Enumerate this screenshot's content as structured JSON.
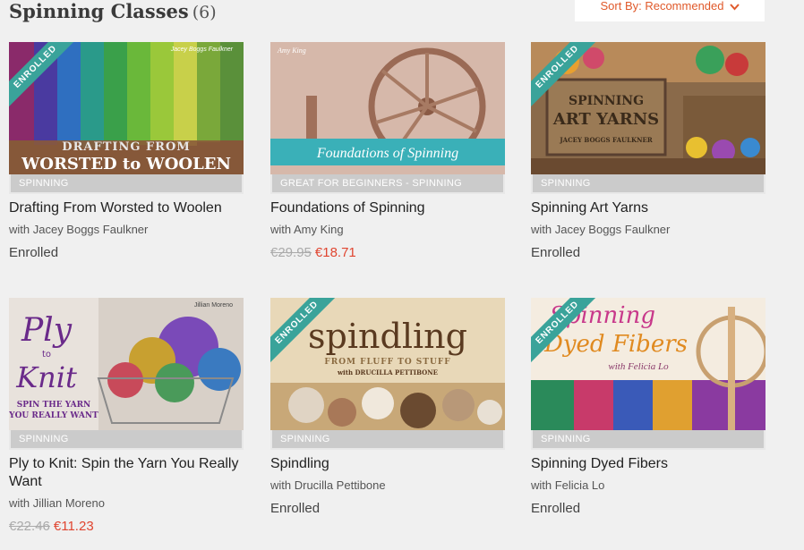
{
  "header": {
    "title": "Spinning Classes",
    "count": "(6)",
    "sort_label": "Sort By: Recommended"
  },
  "colors": {
    "accent": "#e0592a",
    "ribbon": "#3aa39a",
    "sale_price": "#e04530",
    "category_bar": "#cbcbcb"
  },
  "classes": [
    {
      "title": "Drafting From Worsted to Woolen",
      "author": "with Jacey Boggs Faulkner",
      "category": "SPINNING",
      "enrolled_ribbon": "ENROLLED",
      "status": "Enrolled",
      "cover_text": {
        "brand": "Jacey Boggs Faulkner",
        "line1": "DRAFTING FROM",
        "line2": "WORSTED to WOOLEN"
      }
    },
    {
      "title": "Foundations of Spinning",
      "author": "with Amy King",
      "category": "GREAT FOR BEGINNERS - SPINNING",
      "old_price": "€29.95",
      "new_price": "€18.71",
      "cover_text": {
        "brand": "Amy King",
        "line1": "Foundations of Spinning"
      }
    },
    {
      "title": "Spinning Art Yarns",
      "author": "with Jacey Boggs Faulkner",
      "category": "SPINNING",
      "enrolled_ribbon": "ENROLLED",
      "status": "Enrolled",
      "cover_text": {
        "line1": "SPINNING",
        "line2": "ART YARNS",
        "line3": "JACEY BOGGS FAULKNER"
      }
    },
    {
      "title": "Ply to Knit: Spin the Yarn You Really Want",
      "author": "with Jillian Moreno",
      "category": "SPINNING",
      "old_price": "€22.46",
      "new_price": "€11.23",
      "cover_text": {
        "brand": "Jillian Moreno",
        "line1": "Ply",
        "line2": "to",
        "line3": "Knit",
        "line4": "SPIN THE YARN",
        "line5": "YOU REALLY WANT"
      }
    },
    {
      "title": "Spindling",
      "author": "with Drucilla Pettibone",
      "category": "SPINNING",
      "enrolled_ribbon": "ENROLLED",
      "status": "Enrolled",
      "cover_text": {
        "line1": "spindling",
        "line2": "FROM FLUFF TO STUFF",
        "line3": "with DRUCILLA PETTIBONE"
      }
    },
    {
      "title": "Spinning Dyed Fibers",
      "author": "with Felicia Lo",
      "category": "SPINNING",
      "enrolled_ribbon": "ENROLLED",
      "status": "Enrolled",
      "cover_text": {
        "line1": "Spinning",
        "line2": "Dyed Fibers",
        "line3": "with Felicia Lo"
      }
    }
  ]
}
